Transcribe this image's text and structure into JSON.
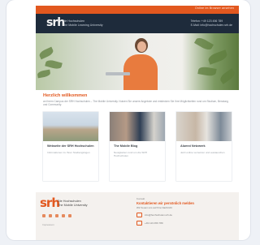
{
  "email": {
    "topbar": {
      "view_in_browser": "Online im Browser ansehen"
    },
    "header": {
      "logo_mark": "srh",
      "logo_line1": "Die Hochschulen",
      "logo_line2": "The Mobile Learning University",
      "contact_line1": "Telefon: +49 123 456 789",
      "contact_line2": "E-Mail: info@hochschulen.srh.de"
    },
    "welcome": {
      "title": "Herzlich willkommen",
      "text": "an Ihrem Campus der SRH Hochschulen – The Mobile University. Nutzen Sie unsere Angebote und entdecken Sie Ihre Möglichkeiten rund um Studium, Beratung und Community."
    },
    "tiles": [
      {
        "title": "Webseite der SRH Hochschulen",
        "text": "Informationen zu Ihren Studiengängen"
      },
      {
        "title": "The Mobile Blog",
        "text": "Neuigkeiten rund um die SRH Hochschulen"
      },
      {
        "title": "Alumni Netzwerk",
        "text": "Jetzt online vernetzen und austauschen"
      }
    ],
    "footer": {
      "logo_mark": "srh",
      "logo_line1": "Die Hochschulen",
      "logo_line2": "The Mobile University",
      "small": "Impressum",
      "label": "Kontakt",
      "title": "Kontaktieren wir persönlich melden",
      "sub": "Wir freuen uns auf Ihre Nachricht",
      "email": "info@hochschulen.srh.de",
      "phone": "+49 123 456 789"
    }
  },
  "colors": {
    "accent": "#e2581f",
    "header": "#1e2b3b"
  }
}
